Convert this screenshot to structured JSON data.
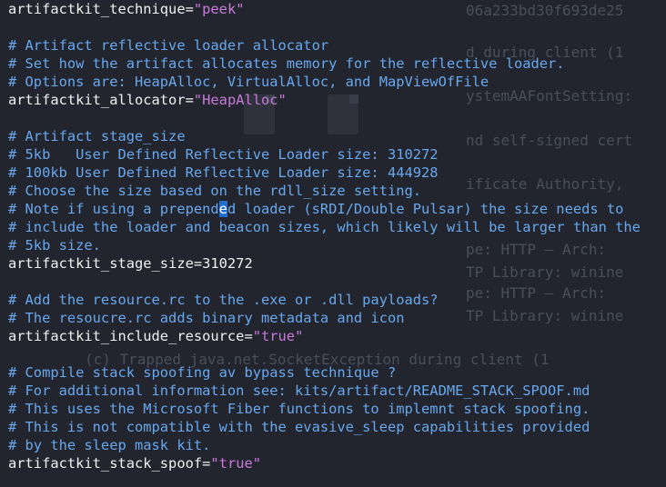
{
  "background_text": [
    "06a233bd30f693de25",
    "d during client (1",
    "ystemAAFontSetting:",
    "nd self-signed cert",
    "ificate Authority,",
    "pe: HTTP — Arch:",
    "TP Library: winine",
    "pe: HTTP — Arch:",
    "TP Library: winine",
    "(c) Trapped java.net.SocketException during client (1"
  ],
  "editor": {
    "lines": [
      {
        "kind": "setting",
        "key": "artifactkit_technique",
        "value": "\"peek\""
      },
      {
        "kind": "blank"
      },
      {
        "kind": "comment",
        "text": "# Artifact reflective loader allocator"
      },
      {
        "kind": "comment",
        "text": "# Set how the artifact allocates memory for the reflective loader."
      },
      {
        "kind": "comment",
        "text": "# Options are: HeapAlloc, VirtualAlloc, and MapViewOfFile"
      },
      {
        "kind": "setting",
        "key": "artifactkit_allocator",
        "value": "\"HeapAlloc\""
      },
      {
        "kind": "blank"
      },
      {
        "kind": "comment",
        "text": "# Artifact stage_size"
      },
      {
        "kind": "comment",
        "text": "# 5kb   User Defined Reflective Loader size: 310272"
      },
      {
        "kind": "comment",
        "text": "# 100kb User Defined Reflective Loader size: 444928"
      },
      {
        "kind": "comment",
        "text": "# Choose the size based on the rdll_size setting."
      },
      {
        "kind": "comment_cursor",
        "before": "# Note if using a prepend",
        "cursor": "e",
        "after": "d loader (sRDI/Double Pulsar) the size needs to"
      },
      {
        "kind": "comment",
        "text": "# include the loader and beacon sizes, which likely will be larger than the"
      },
      {
        "kind": "comment",
        "text": "# 5kb size."
      },
      {
        "kind": "plain",
        "text": "artifactkit_stage_size=310272"
      },
      {
        "kind": "blank"
      },
      {
        "kind": "comment",
        "text": "# Add the resource.rc to the .exe or .dll payloads?"
      },
      {
        "kind": "comment",
        "text": "# The resoucre.rc adds binary metadata and icon"
      },
      {
        "kind": "setting",
        "key": "artifactkit_include_resource",
        "value": "\"true\""
      },
      {
        "kind": "blank"
      },
      {
        "kind": "comment",
        "text": "# Compile stack spoofing av bypass technique ?"
      },
      {
        "kind": "comment",
        "text": "# For additional information see: kits/artifact/README_STACK_SPOOF.md"
      },
      {
        "kind": "comment",
        "text": "# This uses the Microsoft Fiber functions to implemnt stack spoofing."
      },
      {
        "kind": "comment",
        "text": "# This is not compatible with the evasive_sleep capabilities provided"
      },
      {
        "kind": "comment",
        "text": "# by the sleep mask kit."
      },
      {
        "kind": "setting",
        "key": "artifactkit_stack_spoof",
        "value": "\"true\""
      }
    ]
  },
  "colors": {
    "background": "#23252e",
    "comment": "#67a8ee",
    "string": "#c87bd9",
    "text": "#f1f1f1",
    "cursor": "#1f6fd1"
  }
}
